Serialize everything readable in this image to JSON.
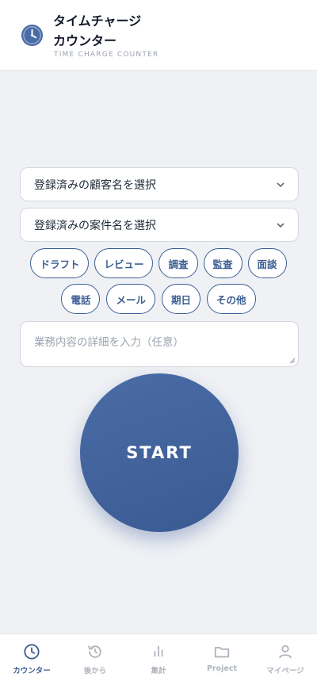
{
  "app": {
    "title_line1": "タイムチャージ",
    "title_line2": "カウンター",
    "subtitle": "TIME CHARGE COUNTER",
    "accent_color": "#3d5f93"
  },
  "form": {
    "client_select": "登録済みの顧客名を選択",
    "case_select": "登録済みの案件名を選択",
    "task_chips_row1": [
      "ドラフト",
      "レビュー",
      "調査",
      "監査",
      "面談"
    ],
    "task_chips_row2": [
      "電話",
      "メール",
      "期日",
      "その他"
    ],
    "details_placeholder": "業務内容の詳細を入力（任意）",
    "start_label": "START"
  },
  "nav": {
    "items": [
      {
        "label": "カウンター",
        "icon": "clock-icon",
        "active": true
      },
      {
        "label": "後から",
        "icon": "history-icon",
        "active": false
      },
      {
        "label": "集計",
        "icon": "bar-chart-icon",
        "active": false
      },
      {
        "label": "Project",
        "icon": "folder-icon",
        "active": false
      },
      {
        "label": "マイページ",
        "icon": "user-icon",
        "active": false
      }
    ]
  }
}
